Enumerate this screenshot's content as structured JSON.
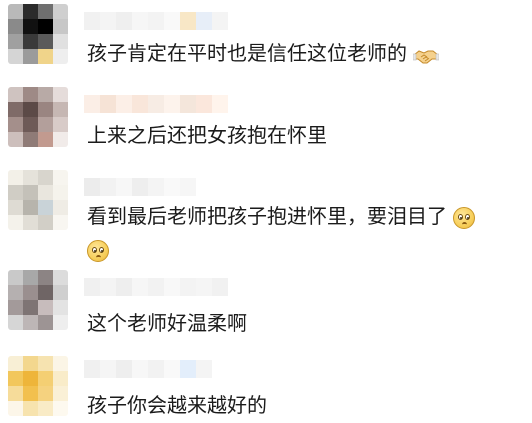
{
  "comments": [
    {
      "text": "孩子肯定在平时也是信任这位老师的",
      "trailing_icon": "handshake-icon",
      "avatar_colors": [
        "#b9b9b9",
        "#2b2b2b",
        "#6f6f6f",
        "#cfcfcf",
        "#8a8a8a",
        "#111111",
        "#000000",
        "#c7c7c7",
        "#a0a0a0",
        "#3a3a3a",
        "#5a5a5a",
        "#e0e0e0",
        "#d5d5d5",
        "#9b9b9b",
        "#f0d48a",
        "#eeeeee"
      ],
      "name_colors": [
        "#f1f1f1",
        "#f4f4f4",
        "#efefef",
        "#f6f6f6",
        "#f3f3f3",
        "#f9f9f9",
        "#f8e7c6",
        "#e7eef8",
        "#f4f4f4"
      ]
    },
    {
      "text": "上来之后还把女孩抱在怀里",
      "trailing_icon": "",
      "avatar_colors": [
        "#cfc3c0",
        "#9e8a86",
        "#b8aaa6",
        "#e5dcda",
        "#7f6b68",
        "#5c4a47",
        "#9a8581",
        "#c6b7b3",
        "#a48f8b",
        "#6e5a57",
        "#b39f9b",
        "#d8cbc8",
        "#cdbfbc",
        "#8f7b77",
        "#c29a8f",
        "#f1ebe9"
      ],
      "name_colors": [
        "#fbeee6",
        "#f6e3d6",
        "#fcefe7",
        "#f9e6da",
        "#f7ece4",
        "#fdf3ec",
        "#f4e6db",
        "#fbe7dc",
        "#fff4ec"
      ]
    },
    {
      "text": "看到最后老师把孩子抱进怀里，要泪目了",
      "trailing_icon": "sad-face-icon",
      "second_line_icon": "sad-face-icon",
      "avatar_colors": [
        "#f3f0e8",
        "#e5e2da",
        "#d8d5cd",
        "#f7f5ef",
        "#d0cdc5",
        "#c4c1b9",
        "#e9e6de",
        "#f5f3ec",
        "#dedbd3",
        "#b7b4ac",
        "#c9d3d8",
        "#efece5",
        "#f4f2eb",
        "#e1ded6",
        "#d2cfc7",
        "#f8f6f1"
      ],
      "name_colors": [
        "#ececec",
        "#f2f2f2",
        "#f7f7f7",
        "#eeeeee",
        "#f4f4f4",
        "#f9f9f9",
        "#f6f6f6"
      ]
    },
    {
      "text": "这个老师好温柔啊",
      "trailing_icon": "",
      "avatar_colors": [
        "#c9c9c9",
        "#a8a8a8",
        "#8c8484",
        "#dcdcdc",
        "#b5b0b0",
        "#9a8f8f",
        "#6f6565",
        "#cfcfcf",
        "#a39a9a",
        "#7e7474",
        "#c7bcbc",
        "#e3e3e3",
        "#d6d6d6",
        "#bdb6b6",
        "#9d9494",
        "#eeeeee"
      ],
      "name_colors": [
        "#f0f0f0",
        "#f4f4f4",
        "#eeeeee",
        "#f6f6f6",
        "#f2f2f2",
        "#f8f8f8",
        "#f3f3f3",
        "#f5f5f5",
        "#f1f1f1"
      ]
    },
    {
      "text": "孩子你会越来越好的",
      "trailing_icon": "",
      "avatar_colors": [
        "#f8efd5",
        "#f3d78e",
        "#f6e3b0",
        "#fbf5e6",
        "#f2c75c",
        "#eeb53a",
        "#f4cf73",
        "#f9ecc9",
        "#f6dc9a",
        "#f2c04e",
        "#f5d27f",
        "#faf0d6",
        "#fcf6e9",
        "#f7e3ae",
        "#f9ebc6",
        "#fdf9ef"
      ],
      "name_colors": [
        "#f0f0f0",
        "#f5f5f5",
        "#eeeeee",
        "#f7f7f7",
        "#f2f2f2",
        "#f9f9f9",
        "#e3eefb",
        "#f4f4f4"
      ]
    }
  ]
}
